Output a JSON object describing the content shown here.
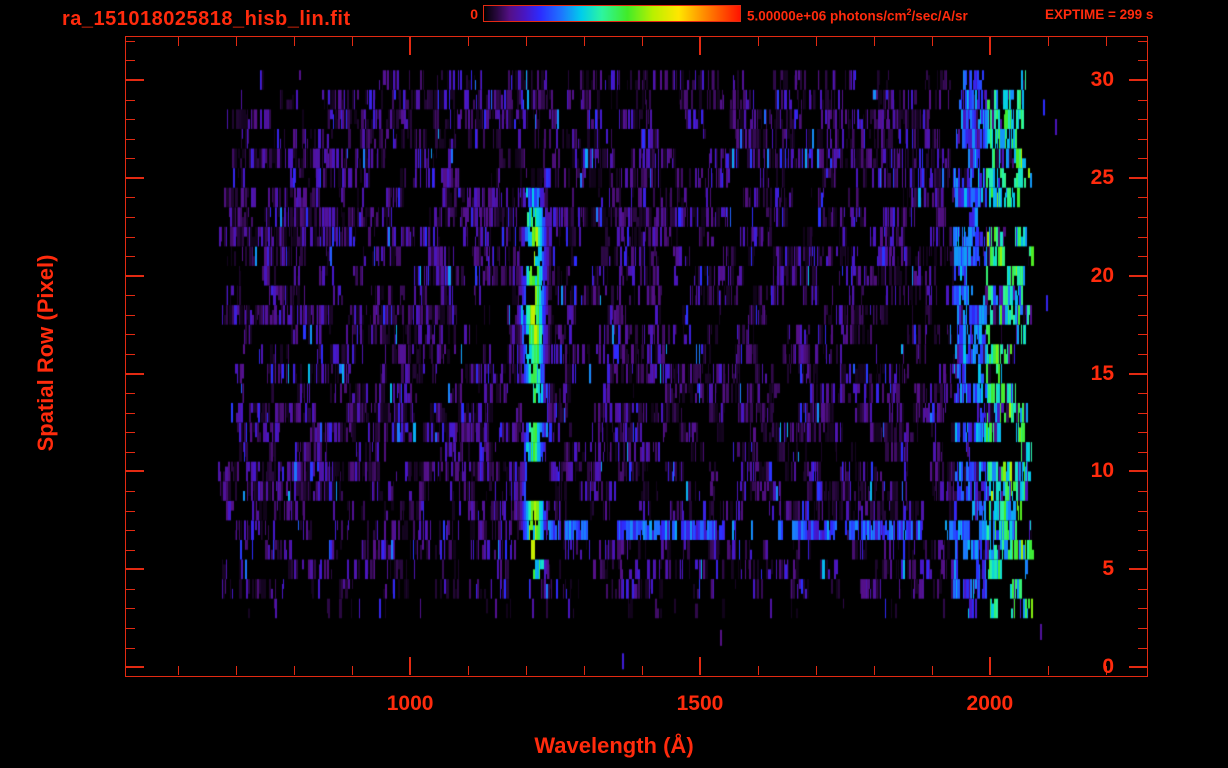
{
  "header": {
    "title": "ra_151018025818_hisb_lin.fit",
    "exptime": "EXPTIME = 299 s",
    "colorbar": {
      "min_label": "0",
      "max_label": "5.00000e+06",
      "units_prefix": " photons/cm",
      "units_sup": "2",
      "units_suffix": "/sec/A/sr"
    }
  },
  "chart_data": {
    "type": "heatmap",
    "title": "ra_151018025818_hisb_lin.fit",
    "xlabel": "Wavelength (Å)",
    "ylabel": "Spatial Row (Pixel)",
    "xlim": [
      510,
      2271
    ],
    "ylim": [
      -0.4,
      32.2
    ],
    "x_major_ticks": [
      1000,
      1500,
      2000
    ],
    "x_minor_step": 100,
    "x_minor_range": [
      600,
      2200
    ],
    "y_major_ticks": [
      0,
      5,
      10,
      15,
      20,
      25,
      30
    ],
    "y_minor_step": 1,
    "y_minor_range": [
      1,
      32
    ],
    "colorbar_range_photons": [
      0,
      5000000
    ],
    "colorbar_units": "photons/cm^2/sec/A/sr",
    "exposure_time_s": 299,
    "legend_position": "top",
    "grid": false,
    "colormap_stops": [
      [
        0.0,
        0,
        0,
        0
      ],
      [
        0.05,
        40,
        8,
        62
      ],
      [
        0.1,
        84,
        16,
        134
      ],
      [
        0.16,
        72,
        22,
        196
      ],
      [
        0.22,
        44,
        44,
        255
      ],
      [
        0.3,
        30,
        115,
        255
      ],
      [
        0.38,
        0,
        205,
        235
      ],
      [
        0.46,
        45,
        245,
        160
      ],
      [
        0.56,
        65,
        235,
        40
      ],
      [
        0.66,
        185,
        240,
        0
      ],
      [
        0.76,
        255,
        230,
        0
      ],
      [
        0.86,
        255,
        140,
        0
      ],
      [
        1.0,
        255,
        20,
        0
      ]
    ],
    "render_seed": 20151018,
    "noise": {
      "row_range": [
        3,
        30
      ],
      "wavelength_start_range": [
        668,
        714
      ],
      "wavelength_end_range": [
        2052,
        2075
      ],
      "base_density_range": [
        0.52,
        0.85
      ],
      "row4_density": 0.5,
      "row3_density": 0.12,
      "gap_chance": 0.035
    },
    "features": {
      "lyman_alpha_stripe": {
        "wavelength": [
          1185,
          1240
        ],
        "rows": [
          5,
          24
        ],
        "peak_value": 0.62,
        "note": "bright green emission stripe"
      },
      "bright_row_streak": {
        "row": 7,
        "wavelength": [
          1235,
          2065
        ],
        "value": [
          0.15,
          0.35
        ],
        "note": "horizontal blue-cyan streak"
      },
      "long_wave_band": {
        "wavelength": [
          1935,
          2075
        ],
        "green_from": 1992,
        "rows": [
          3,
          30
        ],
        "value": [
          0.2,
          0.58
        ],
        "note": "green/cyan band at long wavelengths with rare orange-red edge pixels"
      },
      "row30_gap": {
        "wavelength": [
          745,
          945
        ]
      },
      "strays": [
        {
          "row": 0.3,
          "wavelength": 1365,
          "value": 0.18
        },
        {
          "row": 1.5,
          "wavelength": 1535,
          "value": 0.1
        },
        {
          "row": 1.8,
          "wavelength": 2086,
          "value": 0.12
        },
        {
          "row": 18.6,
          "wavelength": 2096,
          "value": 0.2
        },
        {
          "row": 27.6,
          "wavelength": 2112,
          "value": 0.15
        },
        {
          "row": 28.6,
          "wavelength": 2092,
          "value": 0.22
        }
      ]
    }
  },
  "colors": {
    "text": "#ff2b0d",
    "axis": "#e32a12",
    "background": "#000000"
  }
}
